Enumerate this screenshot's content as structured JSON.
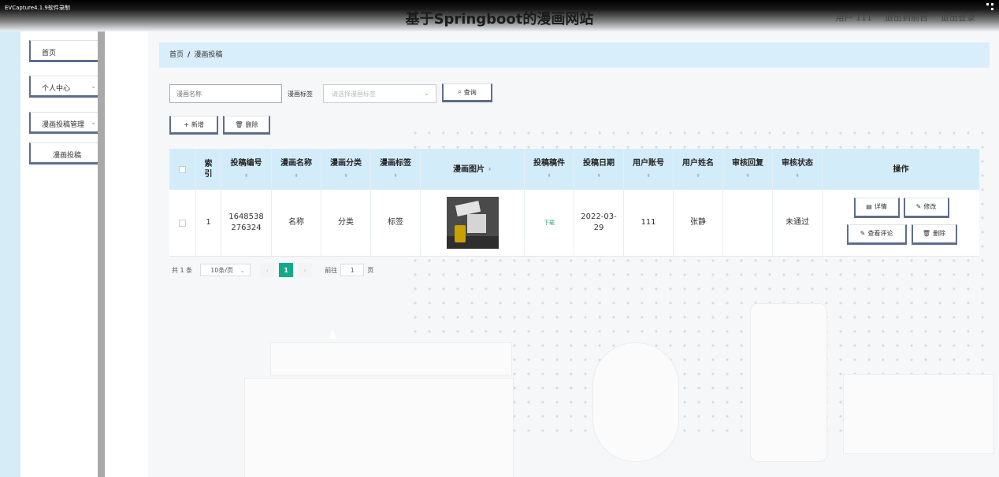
{
  "recorder_label": "EVCapture4.1.9软件录制",
  "header": {
    "title": "基于Springboot的漫画网站",
    "user_label": "用户 111",
    "back_front": "退出到前台",
    "logout": "退出登录"
  },
  "sidebar": {
    "items": [
      {
        "label": "首页"
      },
      {
        "label": "个人中心"
      },
      {
        "label": "漫画投稿管理"
      },
      {
        "label": "漫画投稿"
      }
    ]
  },
  "breadcrumb": {
    "home": "首页",
    "separator": "/",
    "current": "漫画投稿"
  },
  "search": {
    "name_placeholder": "漫画名称",
    "tag_label": "漫画标签",
    "tag_placeholder": "请选择漫画标签",
    "query_label": "查询"
  },
  "toolbar": {
    "add_label": "新增",
    "delete_label": "删除"
  },
  "table": {
    "columns": [
      "索引",
      "投稿编号",
      "漫画名称",
      "漫画分类",
      "漫画标签",
      "漫画图片",
      "投稿稿件",
      "投稿日期",
      "用户账号",
      "用户姓名",
      "审核回复",
      "审核状态",
      "操作"
    ],
    "rows": [
      {
        "index": "1",
        "submission_no": "1648538276324",
        "name": "名称",
        "category": "分类",
        "tag": "标签",
        "file_link": "下载",
        "date": "2022-03-29",
        "account": "111",
        "user_name": "张静",
        "review_reply": "",
        "review_status": "未通过"
      }
    ],
    "actions": {
      "detail": "详情",
      "edit": "修改",
      "comments": "查看评论",
      "delete": "删除"
    }
  },
  "pagination": {
    "total": "共 1 条",
    "page_size": "10条/页",
    "current_page": "1",
    "goto_label": "前往",
    "goto_value": "1",
    "page_unit": "页"
  },
  "colors": {
    "accent": "#13a98a",
    "header_bg": "#d3ecfa",
    "button_border": "#5e6d8c"
  },
  "icons": [
    "search-icon",
    "plus-icon",
    "trash-icon",
    "detail-icon",
    "edit-icon",
    "chevron-down-icon",
    "chevron-left-icon",
    "chevron-right-icon",
    "fullscreen-icon"
  ]
}
